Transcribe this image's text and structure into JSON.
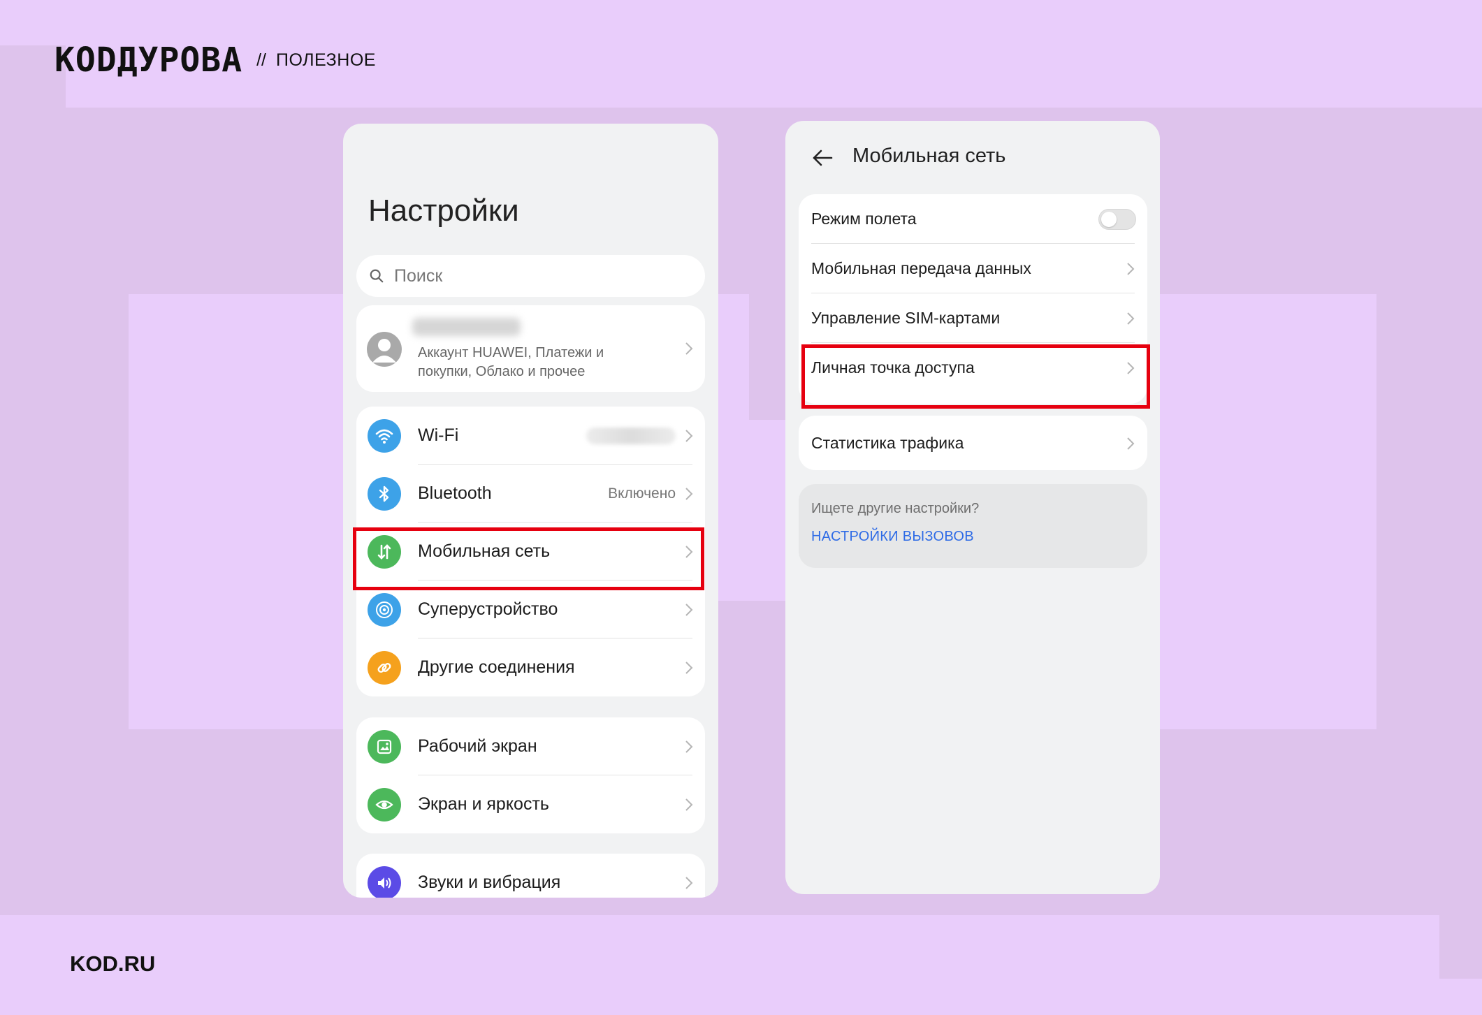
{
  "header": {
    "logo": "KODДУРОВА",
    "separator": "//",
    "section": "ПОЛЕЗНОЕ"
  },
  "footer": {
    "site": "KOD.RU"
  },
  "left_phone": {
    "title": "Настройки",
    "search_placeholder": "Поиск",
    "account": {
      "description": "Аккаунт HUAWEI, Платежи и покупки, Облако и прочее"
    },
    "connections": [
      {
        "label": "Wi‑Fi",
        "value": "",
        "icon": "wifi-icon",
        "color": "#3DA2E8"
      },
      {
        "label": "Bluetooth",
        "value": "Включено",
        "icon": "bluetooth-icon",
        "color": "#3DA2E8"
      },
      {
        "label": "Мобильная сеть",
        "value": "",
        "icon": "mobile-data-icon",
        "color": "#4CB85B",
        "highlighted": true
      },
      {
        "label": "Суперустройство",
        "value": "",
        "icon": "super-device-icon",
        "color": "#3DA2E8"
      },
      {
        "label": "Другие соединения",
        "value": "",
        "icon": "link-icon",
        "color": "#F5A11D"
      }
    ],
    "display": [
      {
        "label": "Рабочий экран",
        "icon": "home-screen-icon",
        "color": "#4CB85B"
      },
      {
        "label": "Экран и яркость",
        "icon": "eye-icon",
        "color": "#4CB85B"
      }
    ],
    "sound": [
      {
        "label": "Звуки и вибрация",
        "icon": "speaker-icon",
        "color": "#5B4BE6"
      }
    ]
  },
  "right_phone": {
    "title": "Мобильная сеть",
    "items": [
      {
        "label": "Режим полета",
        "control": "toggle",
        "on": false
      },
      {
        "label": "Мобильная передача данных",
        "control": "chevron"
      },
      {
        "label": "Управление SIM-картами",
        "control": "chevron"
      },
      {
        "label": "Личная точка доступа",
        "control": "chevron",
        "highlighted": true
      }
    ],
    "traffic": {
      "label": "Статистика трафика"
    },
    "hint": {
      "question": "Ищете другие настройки?",
      "link": "НАСТРОЙКИ ВЫЗОВОВ"
    },
    "highlight_color": "#E6000F"
  }
}
